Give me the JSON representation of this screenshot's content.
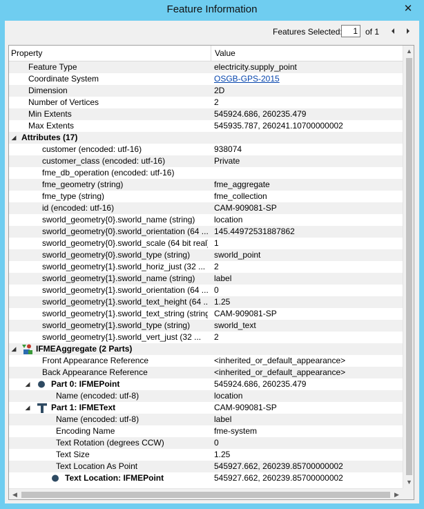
{
  "window": {
    "title": "Feature Information",
    "close_glyph": "✕"
  },
  "toolbar": {
    "features_selected_label": "Features Selected:",
    "current_value": "1",
    "of_label": "of 1"
  },
  "table": {
    "columns": {
      "property": "Property",
      "value": "Value"
    },
    "rows": [
      {
        "property": "Feature Type",
        "value": "electricity.supply_point",
        "level": 0
      },
      {
        "property": "Coordinate System",
        "value": "OSGB-GPS-2015",
        "level": 0,
        "link": true
      },
      {
        "property": "Dimension",
        "value": "2D",
        "level": 0
      },
      {
        "property": "Number of Vertices",
        "value": "2",
        "level": 0
      },
      {
        "property": "Min Extents",
        "value": "545924.686, 260235.479",
        "level": 0
      },
      {
        "property": "Max Extents",
        "value": "545935.787, 260241.10700000002",
        "level": 0
      },
      {
        "property": "Attributes (17)",
        "value": "",
        "level": 0,
        "group": true,
        "expander": "◢",
        "bold": true
      },
      {
        "property": "customer (encoded: utf-16)",
        "value": "938074",
        "level": 1
      },
      {
        "property": "customer_class (encoded: utf-16)",
        "value": "Private",
        "level": 1
      },
      {
        "property": "fme_db_operation (encoded: utf-16)",
        "value": "",
        "level": 1
      },
      {
        "property": "fme_geometry (string)",
        "value": "fme_aggregate",
        "level": 1
      },
      {
        "property": "fme_type (string)",
        "value": "fme_collection",
        "level": 1
      },
      {
        "property": "id (encoded: utf-16)",
        "value": "CAM-909081-SP",
        "level": 1
      },
      {
        "property": "sworld_geometry{0}.sworld_name (string)",
        "value": "location",
        "level": 1
      },
      {
        "property": "sworld_geometry{0}.sworld_orientation (64 ...",
        "value": "145.44972531887862",
        "level": 1
      },
      {
        "property": "sworld_geometry{0}.sworld_scale (64 bit real)",
        "value": "1",
        "level": 1
      },
      {
        "property": "sworld_geometry{0}.sworld_type (string)",
        "value": "sworld_point",
        "level": 1
      },
      {
        "property": "sworld_geometry{1}.sworld_horiz_just (32 ...",
        "value": "2",
        "level": 1
      },
      {
        "property": "sworld_geometry{1}.sworld_name (string)",
        "value": "label",
        "level": 1
      },
      {
        "property": "sworld_geometry{1}.sworld_orientation (64 ...",
        "value": "0",
        "level": 1
      },
      {
        "property": "sworld_geometry{1}.sworld_text_height (64 ...",
        "value": "1.25",
        "level": 1
      },
      {
        "property": "sworld_geometry{1}.sworld_text_string (string)",
        "value": "CAM-909081-SP",
        "level": 1
      },
      {
        "property": "sworld_geometry{1}.sworld_type (string)",
        "value": "sworld_text",
        "level": 1
      },
      {
        "property": "sworld_geometry{1}.sworld_vert_just (32 ...",
        "value": "2",
        "level": 1
      },
      {
        "property": "IFMEAggregate (2 Parts)",
        "value": "",
        "level": 0,
        "group": true,
        "expander": "◢",
        "icon": "aggregate-icon",
        "bold": true
      },
      {
        "property": "Front Appearance Reference",
        "value": "<inherited_or_default_appearance>",
        "level": 1
      },
      {
        "property": "Back Appearance Reference",
        "value": "<inherited_or_default_appearance>",
        "level": 1
      },
      {
        "property": "Part 0: IFMEPoint",
        "value": "545924.686, 260235.479",
        "level": 1,
        "group": true,
        "expander": "◢",
        "icon": "point-icon",
        "bold": true
      },
      {
        "property": "Name (encoded: utf-8)",
        "value": "location",
        "level": 2
      },
      {
        "property": "Part 1: IFMEText",
        "value": "CAM-909081-SP",
        "level": 1,
        "group": true,
        "expander": "◢",
        "icon": "text-icon",
        "bold": true
      },
      {
        "property": "Name (encoded: utf-8)",
        "value": "label",
        "level": 2
      },
      {
        "property": "Encoding Name",
        "value": "fme-system",
        "level": 2
      },
      {
        "property": "Text Rotation (degrees CCW)",
        "value": "0",
        "level": 2
      },
      {
        "property": "Text Size",
        "value": "1.25",
        "level": 2
      },
      {
        "property": "Text Location As Point",
        "value": "545927.662, 260239.85700000002",
        "level": 2
      },
      {
        "property": "Text Location: IFMEPoint",
        "value": "545927.662, 260239.85700000002",
        "level": 2,
        "icon": "point-icon",
        "bold": true
      }
    ]
  },
  "colors": {
    "titlebar": "#6fcdf0",
    "panel": "#f0f0f0",
    "alt_row": "#f0f0f0",
    "link": "#0645ad",
    "point_icon": "#2e4a62",
    "aggregate_icon_green": "#3a9a3a",
    "aggregate_icon_red": "#c0392b",
    "aggregate_icon_blue": "#2c6cb0"
  }
}
